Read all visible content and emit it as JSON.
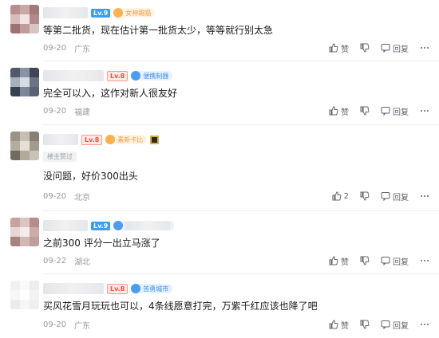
{
  "actions": {
    "like_label": "赞",
    "reply_label": "回复"
  },
  "comments": [
    {
      "level": "Lv.9",
      "level_color": "#3c9df1",
      "medal": "女神踢猫",
      "text": "等第二批货，现在估计第一批货太少，等等就行别太急",
      "date": "09-20",
      "location": "广东",
      "likes": ""
    },
    {
      "level": "Lv.8",
      "level_color": "#ff4b3a",
      "medal": "便携制器",
      "text": "完全可以入，这作对新人很友好",
      "date": "09-20",
      "location": "福建",
      "likes": ""
    },
    {
      "level": "Lv.8",
      "level_color": "#ff4b3a",
      "medal": "素新卡比",
      "tag": "楼主赞过",
      "text": "没问题，好价300出头",
      "date": "09-20",
      "location": "北京",
      "likes": "2"
    },
    {
      "level": "Lv.9",
      "level_color": "#3c9df1",
      "medal": "",
      "text": "之前300 评分一出立马涨了",
      "date": "09-22",
      "location": "湖北",
      "likes": ""
    },
    {
      "level": "Lv.8",
      "level_color": "#ff4b3a",
      "medal": "苦勇城市",
      "text": "买风花雪月玩玩也可以，4条线愿意打完，万紫千红应该也降了吧",
      "date": "09-20",
      "location": "广东",
      "likes": ""
    }
  ]
}
